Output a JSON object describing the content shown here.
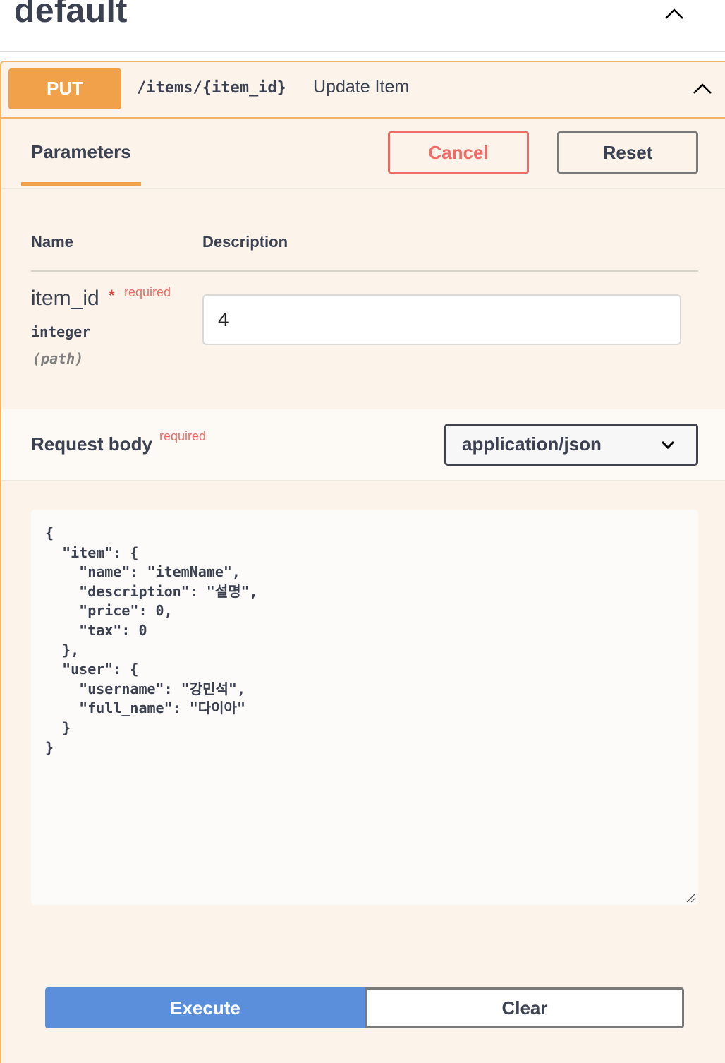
{
  "section": {
    "title": "default"
  },
  "operation": {
    "method": "PUT",
    "path": "/items/{item_id}",
    "summary": "Update Item",
    "method_color": "#f0a14a"
  },
  "tabs": {
    "parameters_label": "Parameters"
  },
  "actions": {
    "cancel_label": "Cancel",
    "reset_label": "Reset"
  },
  "parameters": {
    "col_name": "Name",
    "col_description": "Description",
    "items": [
      {
        "name": "item_id",
        "required_mark": "*",
        "required_label": "required",
        "type": "integer",
        "in": "(path)",
        "value": "4"
      }
    ]
  },
  "request_body": {
    "title": "Request body",
    "required_label": "required",
    "content_type": "application/json",
    "json": "{\n  \"item\": {\n    \"name\": \"itemName\",\n    \"description\": \"설명\",\n    \"price\": 0,\n    \"tax\": 0\n  },\n  \"user\": {\n    \"username\": \"강민석\",\n    \"full_name\": \"다이아\"\n  }\n}"
  },
  "footer": {
    "execute_label": "Execute",
    "clear_label": "Clear"
  },
  "icons": {
    "collapse": "chevron-up-icon",
    "select": "chevron-down-icon",
    "resize": "resize-handle-icon"
  }
}
